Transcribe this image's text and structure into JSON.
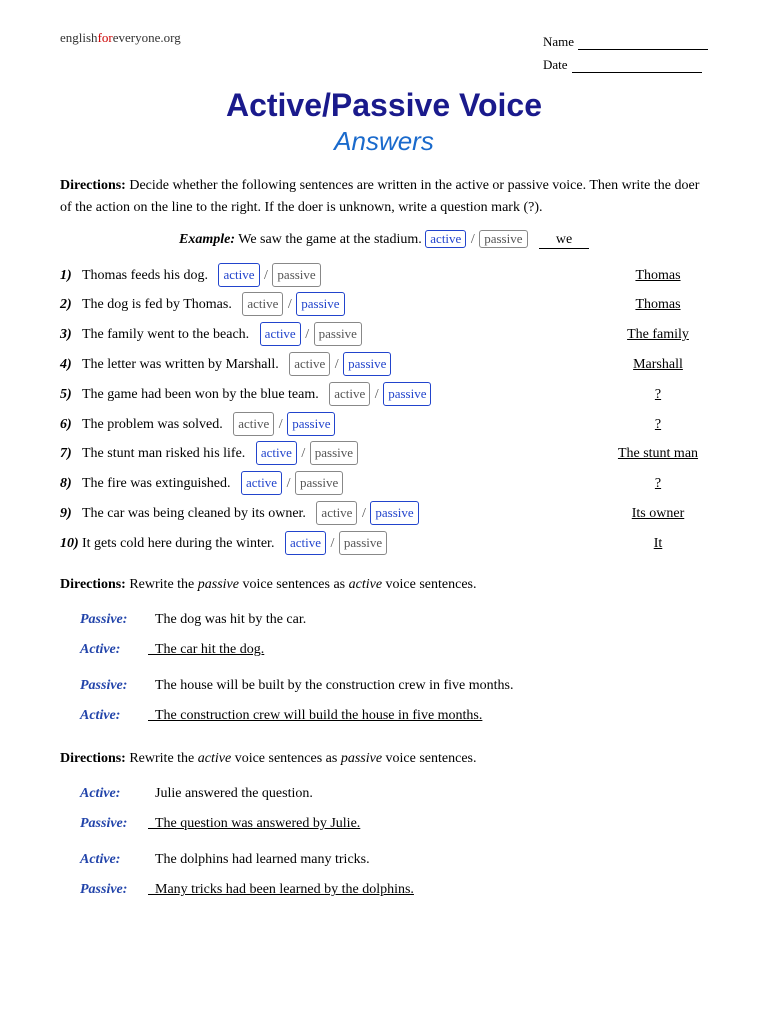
{
  "header": {
    "site": "englishforeveryone.org",
    "site_for": "for",
    "name_label": "Name",
    "date_label": "Date"
  },
  "title": {
    "main": "Active/Passive Voice",
    "subtitle": "Answers"
  },
  "directions1": {
    "label": "Directions:",
    "text": "Decide whether the following sentences are written in the active or passive voice. Then write the doer of the action on the line to the right. If the doer is unknown, write a question mark (?)."
  },
  "example": {
    "label": "Example:",
    "sentence": "We saw the game at the stadium.",
    "badge_active": "active",
    "badge_passive": "passive",
    "answer": "we",
    "selected": "active"
  },
  "sentences": [
    {
      "num": "1)",
      "text": "Thomas feeds his dog.",
      "selected": "active",
      "answer": "Thomas"
    },
    {
      "num": "2)",
      "text": "The dog is fed by Thomas.",
      "selected": "passive",
      "answer": "Thomas"
    },
    {
      "num": "3)",
      "text": "The family went to the beach.",
      "selected": "active",
      "answer": "The family"
    },
    {
      "num": "4)",
      "text": "The letter was written by Marshall.",
      "selected": "passive",
      "answer": "Marshall"
    },
    {
      "num": "5)",
      "text": "The game had been won by the blue team.",
      "selected": "passive",
      "answer": "?"
    },
    {
      "num": "6)",
      "text": "The problem was solved.",
      "selected": "passive",
      "answer": "?"
    },
    {
      "num": "7)",
      "text": "The stunt man risked his life.",
      "selected": "active",
      "answer": "The stunt man"
    },
    {
      "num": "8)",
      "text": "The fire was extinguished.",
      "selected": "active",
      "answer": "?"
    },
    {
      "num": "9)",
      "text": "The car was being cleaned by its owner.",
      "selected": "passive",
      "answer": "Its owner"
    },
    {
      "num": "10)",
      "text": "It gets cold here during the winter.",
      "selected": "active",
      "answer": "It"
    }
  ],
  "directions2": {
    "label": "Directions:",
    "text_before": "Rewrite the",
    "italic1": "passive",
    "text_mid": "voice sentences as",
    "italic2": "active",
    "text_end": "voice sentences."
  },
  "rewrites1": [
    {
      "type": "passive",
      "label": "Passive:",
      "text": "The dog was hit by the car.",
      "underline": false
    },
    {
      "type": "active",
      "label": "Active:",
      "text": "The car hit the dog.",
      "underline": true
    },
    {
      "type": "passive",
      "label": "Passive:",
      "text": "The house will be built by the construction crew in five months.",
      "underline": false
    },
    {
      "type": "active",
      "label": "Active:",
      "text": "The construction crew will build the house in five months.",
      "underline": true
    }
  ],
  "directions3": {
    "label": "Directions:",
    "text_before": "Rewrite the",
    "italic1": "active",
    "text_mid": "voice sentences as",
    "italic2": "passive",
    "text_end": "voice sentences."
  },
  "rewrites2": [
    {
      "type": "active",
      "label": "Active:",
      "text": "Julie answered the question.",
      "underline": false
    },
    {
      "type": "passive",
      "label": "Passive:",
      "text": "The question was answered by Julie.",
      "underline": true
    },
    {
      "type": "active",
      "label": "Active:",
      "text": "The dolphins had learned many tricks.",
      "underline": false
    },
    {
      "type": "passive",
      "label": "Passive:",
      "text": "Many tricks had been learned by the dolphins.",
      "underline": true
    }
  ]
}
